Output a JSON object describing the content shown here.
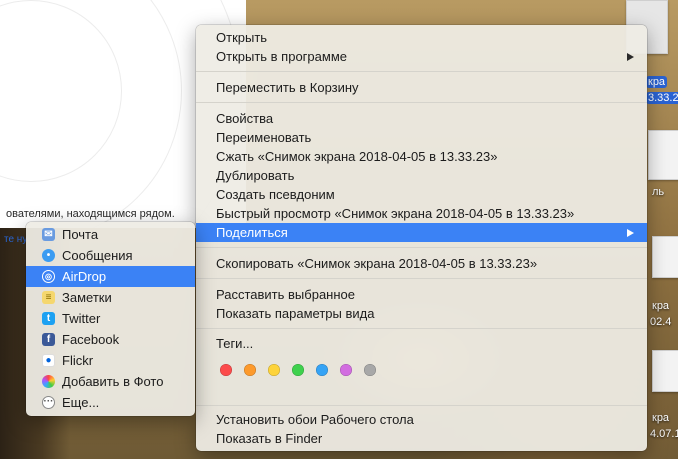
{
  "window": {
    "nearby_text": "ователями, находящимся рядом.",
    "link_text": "те ну"
  },
  "desktop": {
    "labels": [
      "кра",
      "3.33.2",
      "ль",
      "кра",
      "02.4",
      "кра",
      "4.07.1"
    ]
  },
  "main_menu": {
    "open": "Открыть",
    "open_with": "Открыть в программе",
    "move_to_trash": "Переместить в Корзину",
    "properties": "Свойства",
    "rename": "Переименовать",
    "compress": "Сжать «Снимок экрана 2018-04-05 в 13.33.23»",
    "duplicate": "Дублировать",
    "make_alias": "Создать псевдоним",
    "quick_look": "Быстрый просмотр «Снимок экрана 2018-04-05 в 13.33.23»",
    "share": "Поделиться",
    "copy": "Скопировать «Снимок экрана 2018-04-05 в 13.33.23»",
    "arrange": "Расставить выбранное",
    "view_options": "Показать параметры вида",
    "tags": "Теги...",
    "set_wallpaper": "Установить обои Рабочего стола",
    "show_in_finder": "Показать в Finder"
  },
  "tag_colors": [
    {
      "name": "red",
      "hex": "#fc4b4b"
    },
    {
      "name": "orange",
      "hex": "#fd9a2c"
    },
    {
      "name": "yellow",
      "hex": "#fdd33a"
    },
    {
      "name": "green",
      "hex": "#3fd14d"
    },
    {
      "name": "blue",
      "hex": "#35a3f5"
    },
    {
      "name": "purple",
      "hex": "#d26de0"
    },
    {
      "name": "gray",
      "hex": "#a8a8a8"
    }
  ],
  "share_menu": {
    "items": [
      {
        "label": "Почта",
        "icon": "mail-icon"
      },
      {
        "label": "Сообщения",
        "icon": "messages-icon"
      },
      {
        "label": "AirDrop",
        "icon": "airdrop-icon"
      },
      {
        "label": "Заметки",
        "icon": "notes-icon"
      },
      {
        "label": "Twitter",
        "icon": "twitter-icon"
      },
      {
        "label": "Facebook",
        "icon": "facebook-icon"
      },
      {
        "label": "Flickr",
        "icon": "flickr-icon"
      },
      {
        "label": "Добавить в Фото",
        "icon": "photos-icon"
      },
      {
        "label": "Еще...",
        "icon": "more-icon"
      }
    ]
  },
  "colors": {
    "highlight": "#3b82f5"
  }
}
